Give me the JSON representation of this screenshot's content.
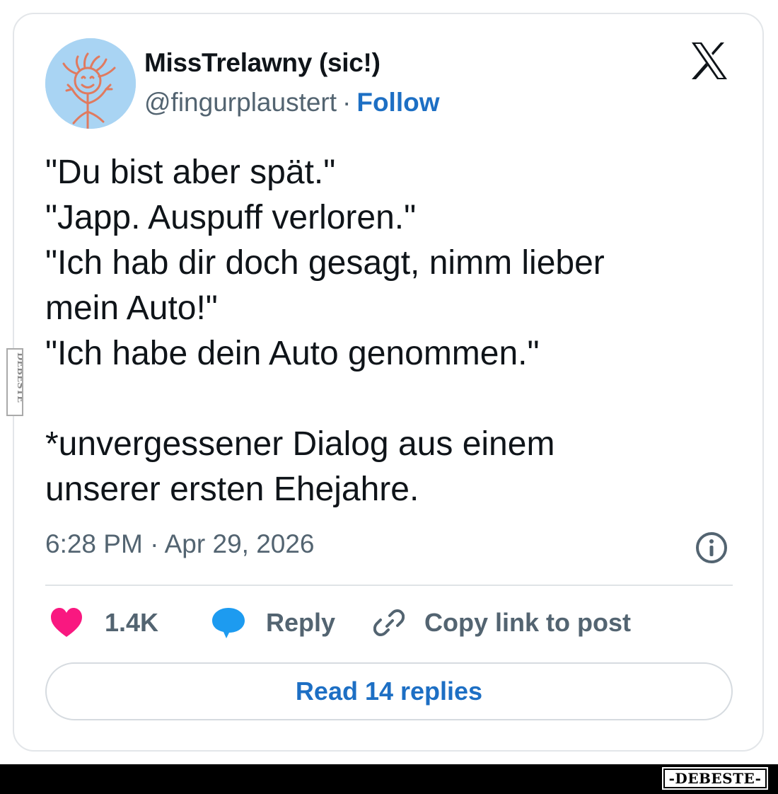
{
  "post": {
    "display_name": "MissTrelawny (sic!)",
    "handle": "@fingurplaustert",
    "separator": "·",
    "follow_label": "Follow",
    "platform_icon": "x-logo-icon",
    "avatar_icon": "stick-figure-drawing-avatar",
    "text_lines": [
      "\"Du bist aber spät.\"",
      "\"Japp. Auspuff verloren.\"",
      "\"Ich hab dir doch gesagt, nimm lieber",
      "mein Auto!\"",
      "\"Ich habe dein Auto genommen.\"",
      "*unvergessener Dialog aus einem",
      "unserer ersten Ehejahre."
    ],
    "timestamp": "6:28 PM · Apr 29, 2026",
    "info_icon": "info-icon"
  },
  "actions": {
    "like_count": "1.4K",
    "like_icon": "heart-icon",
    "reply_label": "Reply",
    "reply_icon": "speech-bubble-icon",
    "copy_label": "Copy link to post",
    "copy_icon": "link-icon",
    "read_replies_label": "Read 14 replies"
  },
  "watermark": {
    "side_text": "DEBESTE",
    "footer_logo_text": "-DEBESTE-"
  },
  "colors": {
    "link_blue": "#1d6fc4",
    "heart_pink": "#f91880",
    "bubble_blue": "#1d9bf0",
    "text_primary": "#0f1419",
    "text_secondary": "#536471",
    "avatar_bg": "#a9d4f3",
    "avatar_drawing": "#e07a5f"
  }
}
